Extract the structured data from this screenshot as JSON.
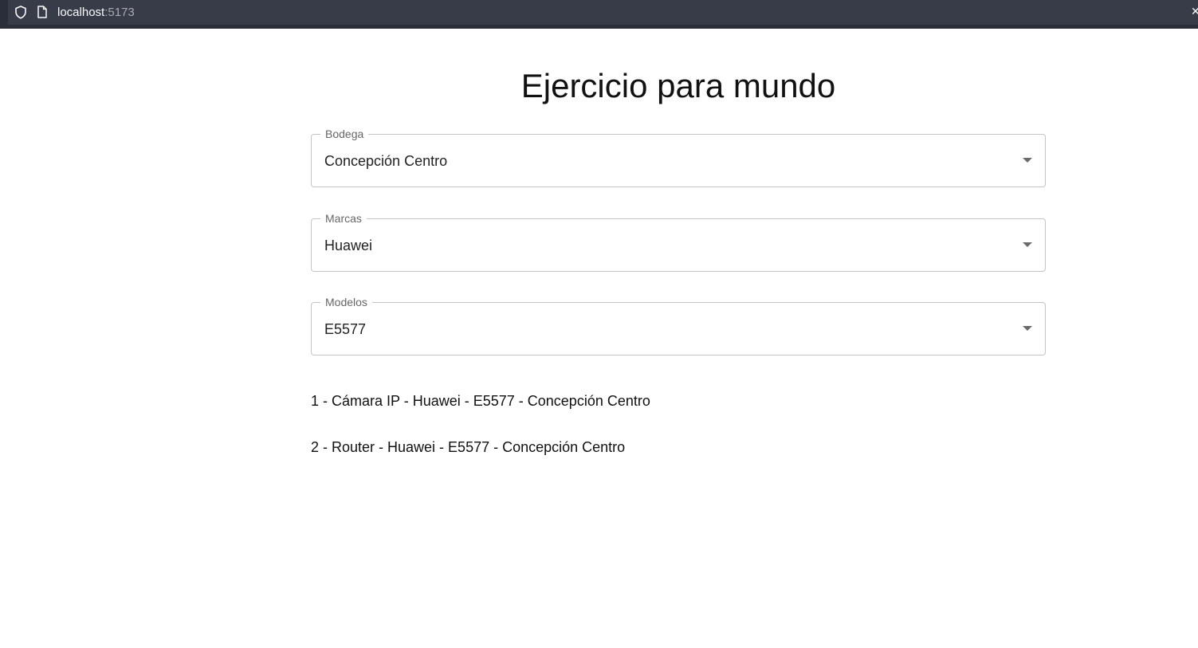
{
  "browser": {
    "url_host": "localhost",
    "url_port": ":5173"
  },
  "page": {
    "title": "Ejercicio para mundo"
  },
  "fields": {
    "bodega": {
      "label": "Bodega",
      "value": "Concepción Centro"
    },
    "marcas": {
      "label": "Marcas",
      "value": "Huawei"
    },
    "modelos": {
      "label": "Modelos",
      "value": "E5577"
    }
  },
  "results": [
    "1 - Cámara IP - Huawei - E5577 - Concepción Centro",
    "2 - Router - Huawei - E5577 - Concepción Centro"
  ]
}
